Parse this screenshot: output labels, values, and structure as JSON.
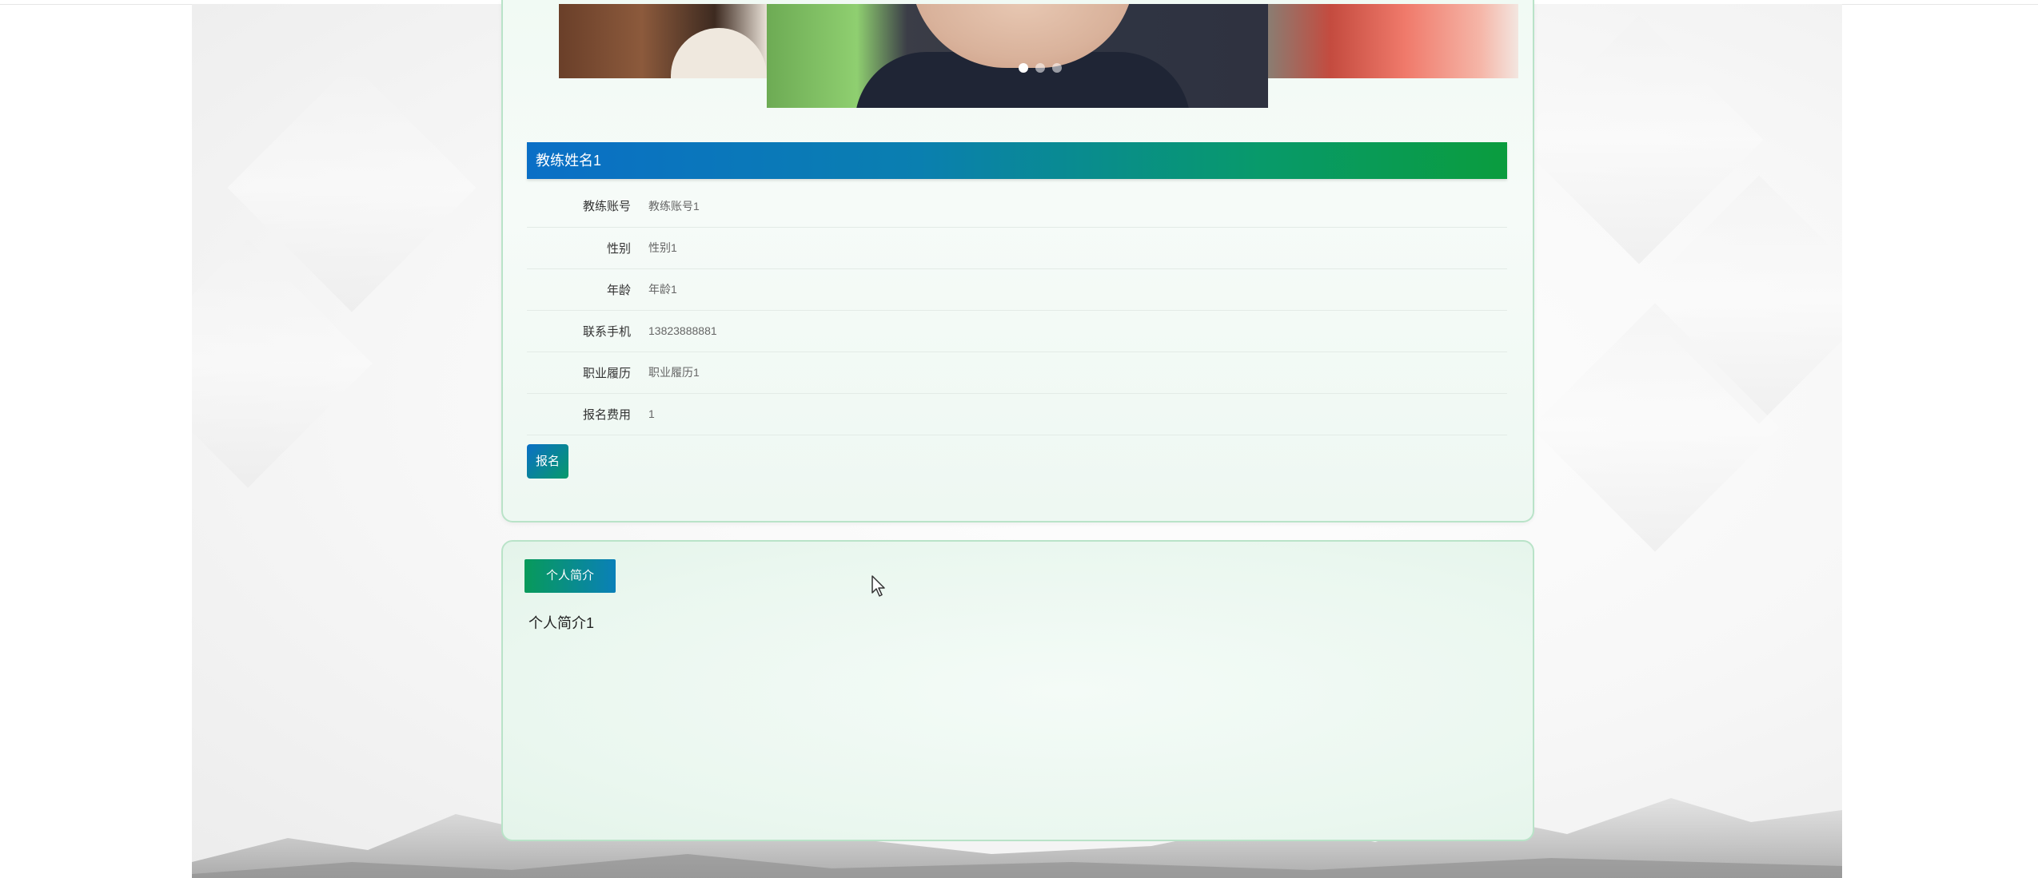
{
  "carousel": {
    "slide_count": 3,
    "active_index": 0
  },
  "detail": {
    "title": "教练姓名1",
    "fields": [
      {
        "label": "教练账号",
        "value": "教练账号1"
      },
      {
        "label": "性别",
        "value": "性别1"
      },
      {
        "label": "年龄",
        "value": "年龄1"
      },
      {
        "label": "联系手机",
        "value": "13823888881"
      },
      {
        "label": "职业履历",
        "value": "职业履历1"
      },
      {
        "label": "报名费用",
        "value": "1"
      }
    ],
    "signup_label": "报名"
  },
  "intro": {
    "tab_label": "个人简介",
    "content": "个人简介1"
  },
  "colors": {
    "header_gradient_start": "#0a6fc6",
    "header_gradient_end": "#0a9c3e",
    "card_border": "#b9e3c8"
  }
}
